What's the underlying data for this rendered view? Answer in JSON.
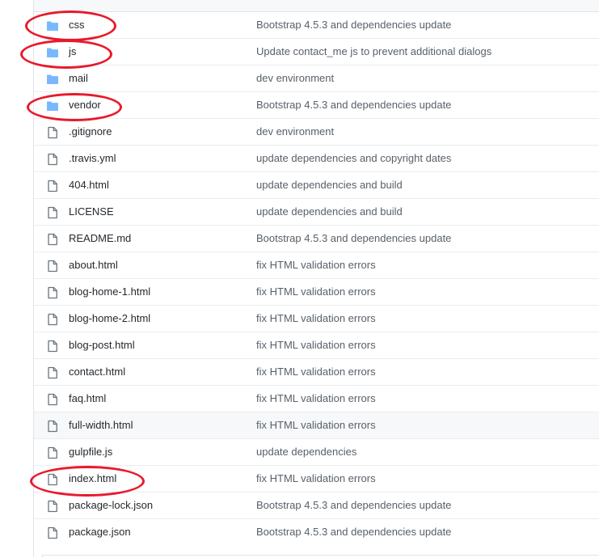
{
  "files": [
    {
      "name": "css",
      "type": "folder",
      "message": "Bootstrap 4.5.3 and dependencies update",
      "icon": "folder-icon"
    },
    {
      "name": "js",
      "type": "folder",
      "message": "Update contact_me js to prevent additional dialogs",
      "icon": "folder-icon"
    },
    {
      "name": "mail",
      "type": "folder",
      "message": "dev environment",
      "icon": "folder-icon"
    },
    {
      "name": "vendor",
      "type": "folder",
      "message": "Bootstrap 4.5.3 and dependencies update",
      "icon": "folder-icon"
    },
    {
      "name": ".gitignore",
      "type": "file",
      "message": "dev environment",
      "icon": "file-icon"
    },
    {
      "name": ".travis.yml",
      "type": "file",
      "message": "update dependencies and copyright dates",
      "icon": "file-icon"
    },
    {
      "name": "404.html",
      "type": "file",
      "message": "update dependencies and build",
      "icon": "file-icon"
    },
    {
      "name": "LICENSE",
      "type": "file",
      "message": "update dependencies and build",
      "icon": "file-icon"
    },
    {
      "name": "README.md",
      "type": "file",
      "message": "Bootstrap 4.5.3 and dependencies update",
      "icon": "file-icon"
    },
    {
      "name": "about.html",
      "type": "file",
      "message": "fix HTML validation errors",
      "icon": "file-icon"
    },
    {
      "name": "blog-home-1.html",
      "type": "file",
      "message": "fix HTML validation errors",
      "icon": "file-icon"
    },
    {
      "name": "blog-home-2.html",
      "type": "file",
      "message": "fix HTML validation errors",
      "icon": "file-icon"
    },
    {
      "name": "blog-post.html",
      "type": "file",
      "message": "fix HTML validation errors",
      "icon": "file-icon"
    },
    {
      "name": "contact.html",
      "type": "file",
      "message": "fix HTML validation errors",
      "icon": "file-icon"
    },
    {
      "name": "faq.html",
      "type": "file",
      "message": "fix HTML validation errors",
      "icon": "file-icon"
    },
    {
      "name": "full-width.html",
      "type": "file",
      "message": "fix HTML validation errors",
      "icon": "file-icon"
    },
    {
      "name": "gulpfile.js",
      "type": "file",
      "message": "update dependencies",
      "icon": "file-icon"
    },
    {
      "name": "index.html",
      "type": "file",
      "message": "fix HTML validation errors",
      "icon": "file-icon"
    },
    {
      "name": "package-lock.json",
      "type": "file",
      "message": "Bootstrap 4.5.3 and dependencies update",
      "icon": "file-icon"
    },
    {
      "name": "package.json",
      "type": "file",
      "message": "Bootstrap 4.5.3 and dependencies update",
      "icon": "file-icon"
    }
  ],
  "colors": {
    "folder": "#79b8ff",
    "file_icon": "#6a737d",
    "annotation": "#e8192c"
  }
}
